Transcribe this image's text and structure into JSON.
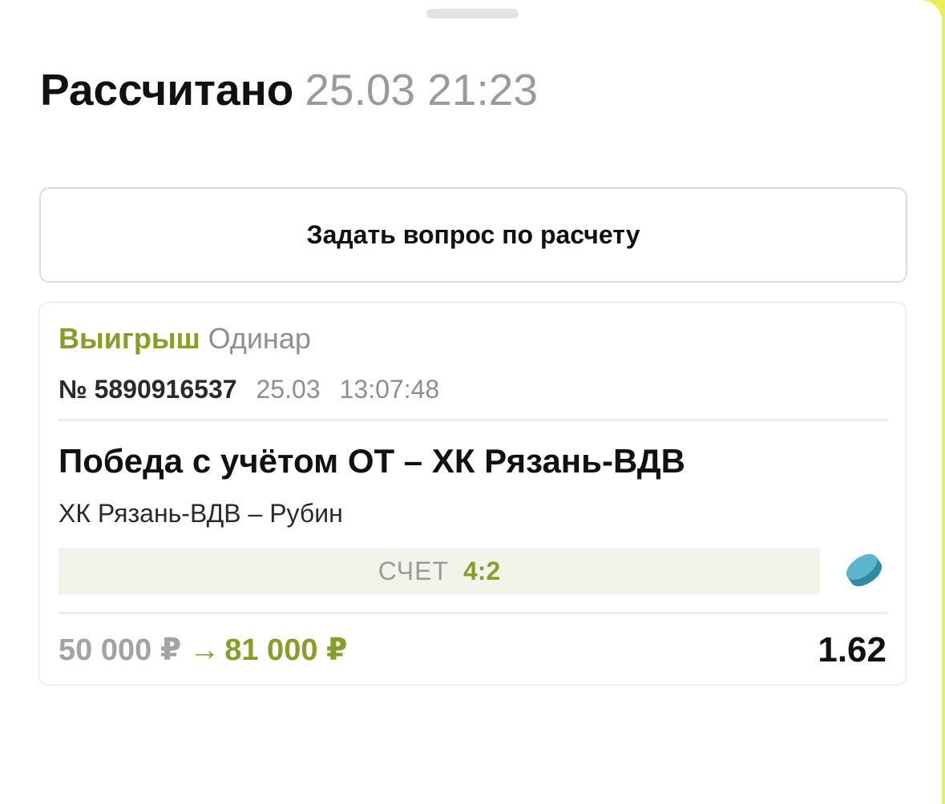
{
  "header": {
    "title": "Рассчитано",
    "datetime": "25.03 21:23"
  },
  "actions": {
    "ask_question_label": "Задать вопрос по расчету"
  },
  "bet": {
    "result": "Выигрыш",
    "type": "Одинар",
    "number": "№ 5890916537",
    "date": "25.03",
    "time": "13:07:48",
    "market": "Победа с учётом ОТ – ХК Рязань-ВДВ",
    "event": "ХК Рязань-ВДВ – Рубин",
    "score_label": "СЧЕТ",
    "score_value": "4:2",
    "sport_icon": "hockey-puck-icon",
    "stake": "50 000 ₽",
    "arrow": "→",
    "payout": "81 000 ₽",
    "odds": "1.62"
  },
  "colors": {
    "win_green": "#84a02b",
    "score_bg": "#f2f4ea",
    "puck_blue": "#4aa8c2",
    "muted_text": "#8f8f8f"
  }
}
